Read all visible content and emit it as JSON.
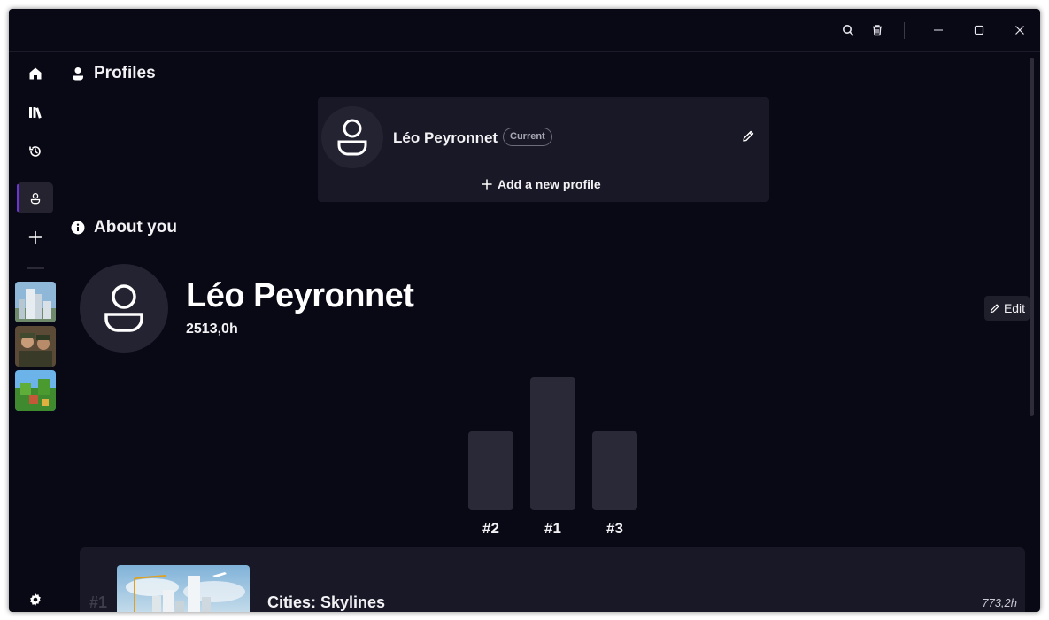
{
  "window": {
    "titlebar": {
      "search_icon": "search-icon",
      "trash_icon": "trash-icon",
      "minimize_icon": "minimize-icon",
      "maximize_icon": "maximize-icon",
      "close_icon": "close-icon"
    }
  },
  "sidebar": {
    "items": [
      {
        "name": "home",
        "icon": "home-icon"
      },
      {
        "name": "library",
        "icon": "library-icon"
      },
      {
        "name": "history",
        "icon": "history-icon"
      },
      {
        "name": "profiles",
        "icon": "profile-icon",
        "active": true
      },
      {
        "name": "add",
        "icon": "plus-icon"
      }
    ],
    "settings_icon": "gear-icon"
  },
  "profiles": {
    "title": "Profiles",
    "current_profile_name": "Léo Peyronnet",
    "current_badge": "Current",
    "add_profile_label": "Add a new profile"
  },
  "about": {
    "title": "About you",
    "name": "Léo Peyronnet",
    "total_hours": "2513,0h",
    "edit_label": "Edit"
  },
  "podium": {
    "labels": [
      "#2",
      "#1",
      "#3"
    ]
  },
  "top_games": [
    {
      "rank": "#1",
      "title": "Cities: Skylines",
      "hours": "773,2h"
    }
  ],
  "colors": {
    "background": "#090815",
    "card": "#191826",
    "accent": "#6a36d6"
  }
}
